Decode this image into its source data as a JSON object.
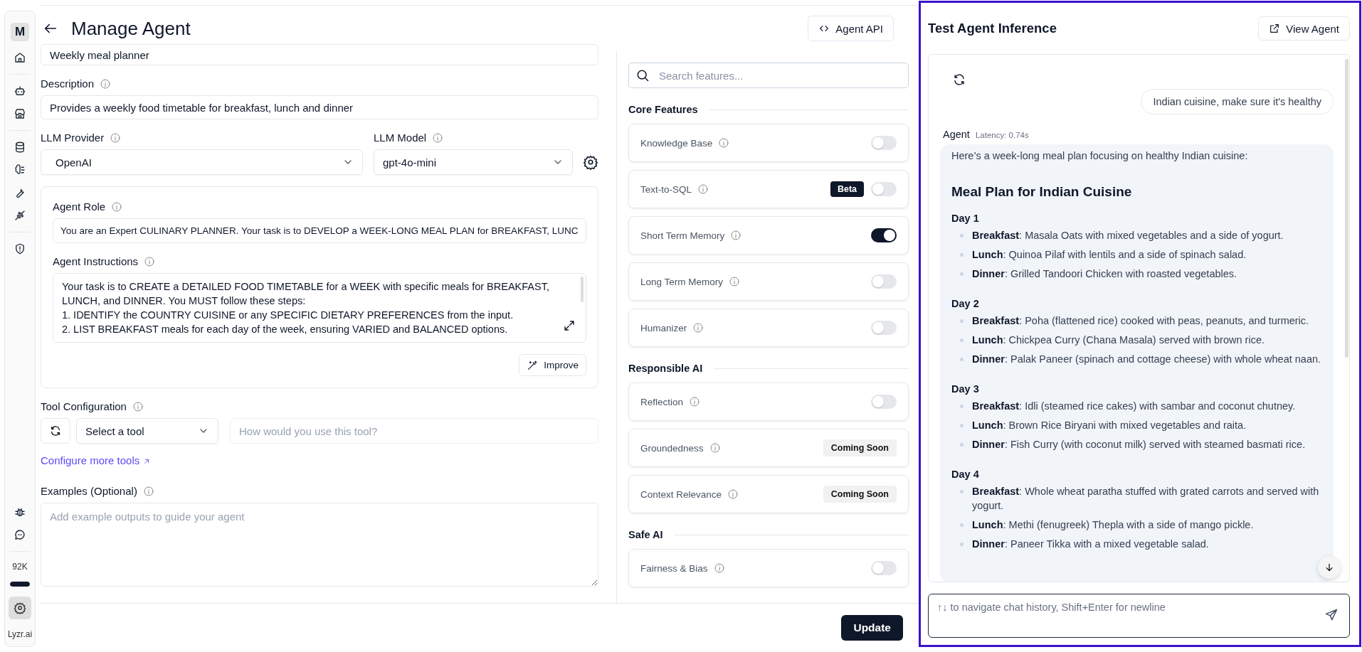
{
  "sidebar": {
    "avatar": "M",
    "usage": {
      "label": "92K",
      "level": 1
    },
    "brand": "Lyzr.ai"
  },
  "header": {
    "title": "Manage Agent",
    "api_button": "Agent API"
  },
  "form": {
    "name_value": "Weekly meal planner",
    "description": {
      "label": "Description",
      "value": "Provides a weekly food timetable for breakfast, lunch and dinner"
    },
    "provider": {
      "label": "LLM Provider",
      "value": "OpenAI"
    },
    "model": {
      "label": "LLM Model",
      "value": "gpt-4o-mini"
    },
    "role": {
      "label": "Agent Role",
      "value": "You are an Expert CULINARY PLANNER. Your task is to DEVELOP a WEEK-LONG MEAL PLAN for BREAKFAST, LUNC"
    },
    "instructions": {
      "label": "Agent Instructions",
      "lines": [
        "Your task is to CREATE a DETAILED FOOD TIMETABLE for a WEEK with specific meals for BREAKFAST, LUNCH, and DINNER. You MUST follow these steps:",
        "1. IDENTIFY the COUNTRY CUISINE or any SPECIFIC DIETARY PREFERENCES from the input.",
        "2. LIST BREAKFAST meals for each day of the week, ensuring VARIED and BALANCED options."
      ]
    },
    "improve_button": "Improve",
    "tools": {
      "label": "Tool Configuration",
      "select": "Select a tool",
      "placeholder": "How would you use this tool?",
      "link": "Configure more tools"
    },
    "examples": {
      "label": "Examples (Optional)",
      "placeholder": "Add example outputs to guide your agent"
    }
  },
  "features": {
    "search_placeholder": "Search features...",
    "sections": [
      {
        "title": "Core Features",
        "items": [
          {
            "label": "Knowledge Base",
            "kind": "toggle",
            "on": false
          },
          {
            "label": "Text-to-SQL",
            "kind": "toggle",
            "on": false,
            "badge": "Beta"
          },
          {
            "label": "Short Term Memory",
            "kind": "toggle",
            "on": true
          },
          {
            "label": "Long Term Memory",
            "kind": "toggle",
            "on": false
          },
          {
            "label": "Humanizer",
            "kind": "toggle",
            "on": false
          }
        ]
      },
      {
        "title": "Responsible AI",
        "items": [
          {
            "label": "Reflection",
            "kind": "toggle",
            "on": false
          },
          {
            "label": "Groundedness",
            "kind": "soon",
            "badge": "Coming Soon"
          },
          {
            "label": "Context Relevance",
            "kind": "soon",
            "badge": "Coming Soon"
          }
        ]
      },
      {
        "title": "Safe AI",
        "items": [
          {
            "label": "Fairness & Bias",
            "kind": "toggle",
            "on": false
          }
        ]
      }
    ]
  },
  "footer": {
    "update_button": "Update"
  },
  "test_panel": {
    "title": "Test Agent Inference",
    "view_button": "View Agent",
    "user_message": "Indian cuisine, make sure it's healthy",
    "agent_label": "Agent",
    "latency": "Latency: 0.74s",
    "intro": "Here’s a week-long meal plan focusing on healthy Indian cuisine:",
    "heading": "Meal Plan for Indian Cuisine",
    "days": [
      {
        "title": "Day 1",
        "meals": [
          "**Breakfast**: Masala Oats with mixed vegetables and a side of yogurt.",
          "**Lunch**: Quinoa Pilaf with lentils and a side of spinach salad.",
          "**Dinner**: Grilled Tandoori Chicken with roasted vegetables."
        ]
      },
      {
        "title": "Day 2",
        "meals": [
          "**Breakfast**: Poha (flattened rice) cooked with peas, peanuts, and turmeric.",
          "**Lunch**: Chickpea Curry (Chana Masala) served with brown rice.",
          "**Dinner**: Palak Paneer (spinach and cottage cheese) with whole wheat naan."
        ]
      },
      {
        "title": "Day 3",
        "meals": [
          "**Breakfast**: Idli (steamed rice cakes) with sambar and coconut chutney.",
          "**Lunch**: Brown Rice Biryani with mixed vegetables and raita.",
          "**Dinner**: Fish Curry (with coconut milk) served with steamed basmati rice."
        ]
      },
      {
        "title": "Day 4",
        "meals": [
          "**Breakfast**: Whole wheat paratha stuffed with grated carrots and served with yogurt.",
          "**Lunch**: Methi (fenugreek) Thepla with a side of mango pickle.",
          "**Dinner**: Paneer Tikka with a mixed vegetable salad."
        ]
      }
    ],
    "input_placeholder": "↑↓ to navigate chat history, Shift+Enter for newline"
  }
}
